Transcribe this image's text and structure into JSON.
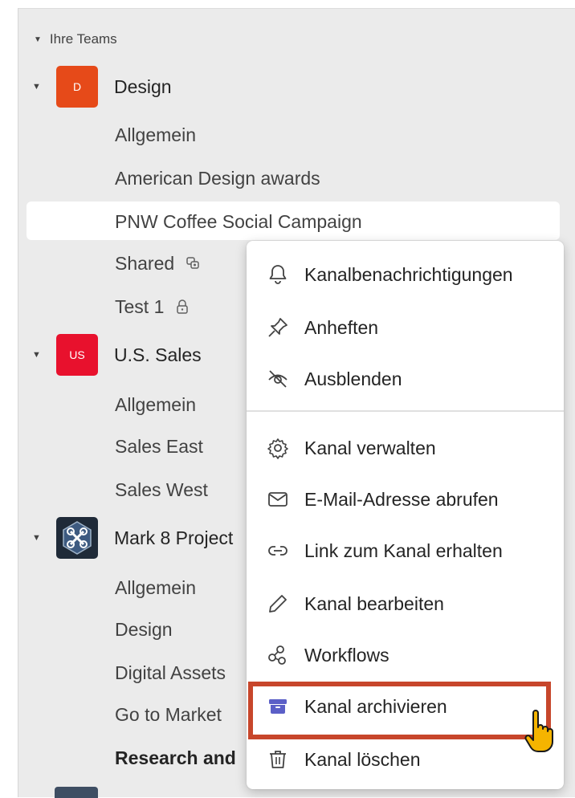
{
  "section": {
    "label": "Ihre Teams"
  },
  "teams": [
    {
      "name": "Design",
      "initials": "D",
      "color": "#e64a19",
      "channels": [
        {
          "name": "Allgemein"
        },
        {
          "name": "American Design awards"
        },
        {
          "name": "PNW Coffee Social Campaign",
          "selected": true
        },
        {
          "name": "Shared",
          "icon": "shared-channel-icon"
        },
        {
          "name": "Test 1",
          "icon": "lock-icon"
        }
      ]
    },
    {
      "name": "U.S. Sales",
      "initials": "US",
      "color": "#e8112d",
      "channels": [
        {
          "name": "Allgemein"
        },
        {
          "name": "Sales East"
        },
        {
          "name": "Sales West"
        }
      ]
    },
    {
      "name": "Mark 8 Project",
      "initials": "",
      "color": "#2f3e52",
      "icon": "drone-icon",
      "channels": [
        {
          "name": "Allgemein"
        },
        {
          "name": "Design"
        },
        {
          "name": "Digital Assets"
        },
        {
          "name": "Go to Market"
        },
        {
          "name": "Research and",
          "bold": true
        }
      ]
    }
  ],
  "context_menu": {
    "items": [
      {
        "label": "Kanalbenachrichtigungen",
        "icon": "bell-icon"
      },
      {
        "label": "Anheften",
        "icon": "pin-icon"
      },
      {
        "label": "Ausblenden",
        "icon": "eye-off-icon"
      },
      {
        "label": "Kanal verwalten",
        "icon": "gear-icon"
      },
      {
        "label": "E-Mail-Adresse abrufen",
        "icon": "mail-icon"
      },
      {
        "label": "Link zum Kanal erhalten",
        "icon": "link-icon"
      },
      {
        "label": "Kanal bearbeiten",
        "icon": "pencil-icon"
      },
      {
        "label": "Workflows",
        "icon": "workflow-icon"
      },
      {
        "label": "Kanal archivieren",
        "icon": "archive-icon",
        "highlighted": true,
        "accent": "#5b5fc7"
      },
      {
        "label": "Kanal löschen",
        "icon": "trash-icon"
      }
    ]
  },
  "annotation": {
    "highlight_color": "#c7462b"
  }
}
